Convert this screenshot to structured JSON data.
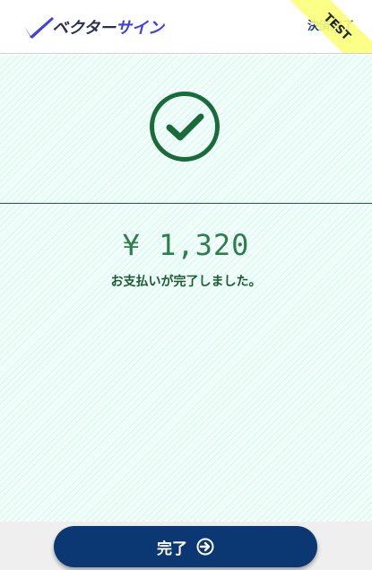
{
  "header": {
    "logo_text_part1": "ベクター",
    "logo_text_part2": "サイン",
    "page_status": "決済完了",
    "test_ribbon": "TEST"
  },
  "payment": {
    "amount": "¥ 1,320",
    "message": "お支払いが完了しました。"
  },
  "footer": {
    "done_label": "完了"
  },
  "colors": {
    "brand_navy": "#0b3772",
    "success_green": "#1a6b3c",
    "background_mint": "#f2fffb",
    "ribbon_yellow": "#fbff7a"
  },
  "icons": {
    "logo": "checkmark-slash-logo-icon",
    "success": "circle-check-icon",
    "done": "circle-arrow-right-icon"
  }
}
